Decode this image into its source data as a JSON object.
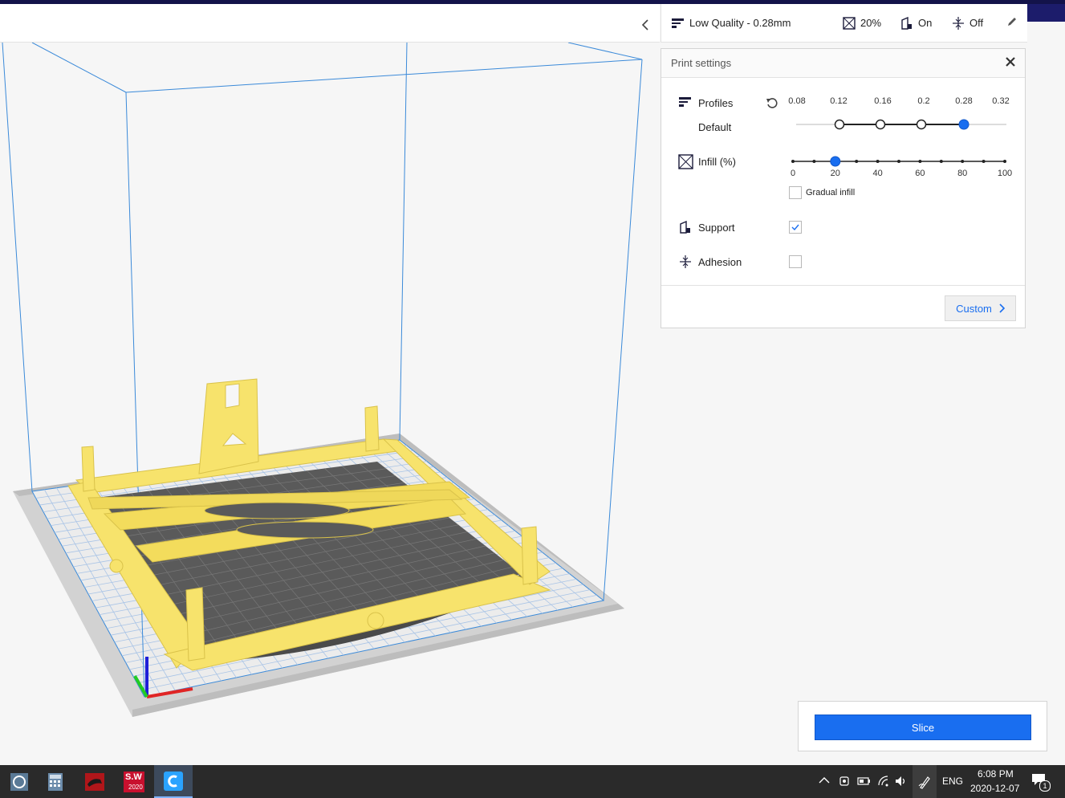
{
  "header": {
    "quality_label": "Low Quality - 0.28mm",
    "infill_value": "20%",
    "support_value": "On",
    "adhesion_value": "Off"
  },
  "print_settings": {
    "title": "Print settings",
    "profiles_label": "Profiles",
    "profile_value": "Default",
    "layer_heights": [
      "0.08",
      "0.12",
      "0.16",
      "0.2",
      "0.28",
      "0.32"
    ],
    "selected_layer_height": "0.28",
    "infill_label": "Infill (%)",
    "infill_ticks": [
      "0",
      "20",
      "40",
      "60",
      "80",
      "100"
    ],
    "infill_percent": 20,
    "gradual_infill_label": "Gradual infill",
    "gradual_infill_checked": false,
    "support_label": "Support",
    "support_checked": true,
    "adhesion_label": "Adhesion",
    "adhesion_checked": false,
    "custom_label": "Custom"
  },
  "slice": {
    "button_label": "Slice"
  },
  "taskbar": {
    "apps": [
      "cortana-icon",
      "calculator-icon",
      "viewer-icon",
      "solidworks-icon",
      "cura-icon"
    ],
    "sw_badge": "S.W",
    "sw_year": "2020",
    "language": "ENG",
    "time": "6:08 PM",
    "date": "2020-12-07",
    "notification_count": "1"
  },
  "colors": {
    "accent": "#196ef0",
    "model": "#f7e36c",
    "build_volume": "#3b8ad9",
    "taskbar": "#2a2a2a",
    "top_bar": "#13134a"
  }
}
